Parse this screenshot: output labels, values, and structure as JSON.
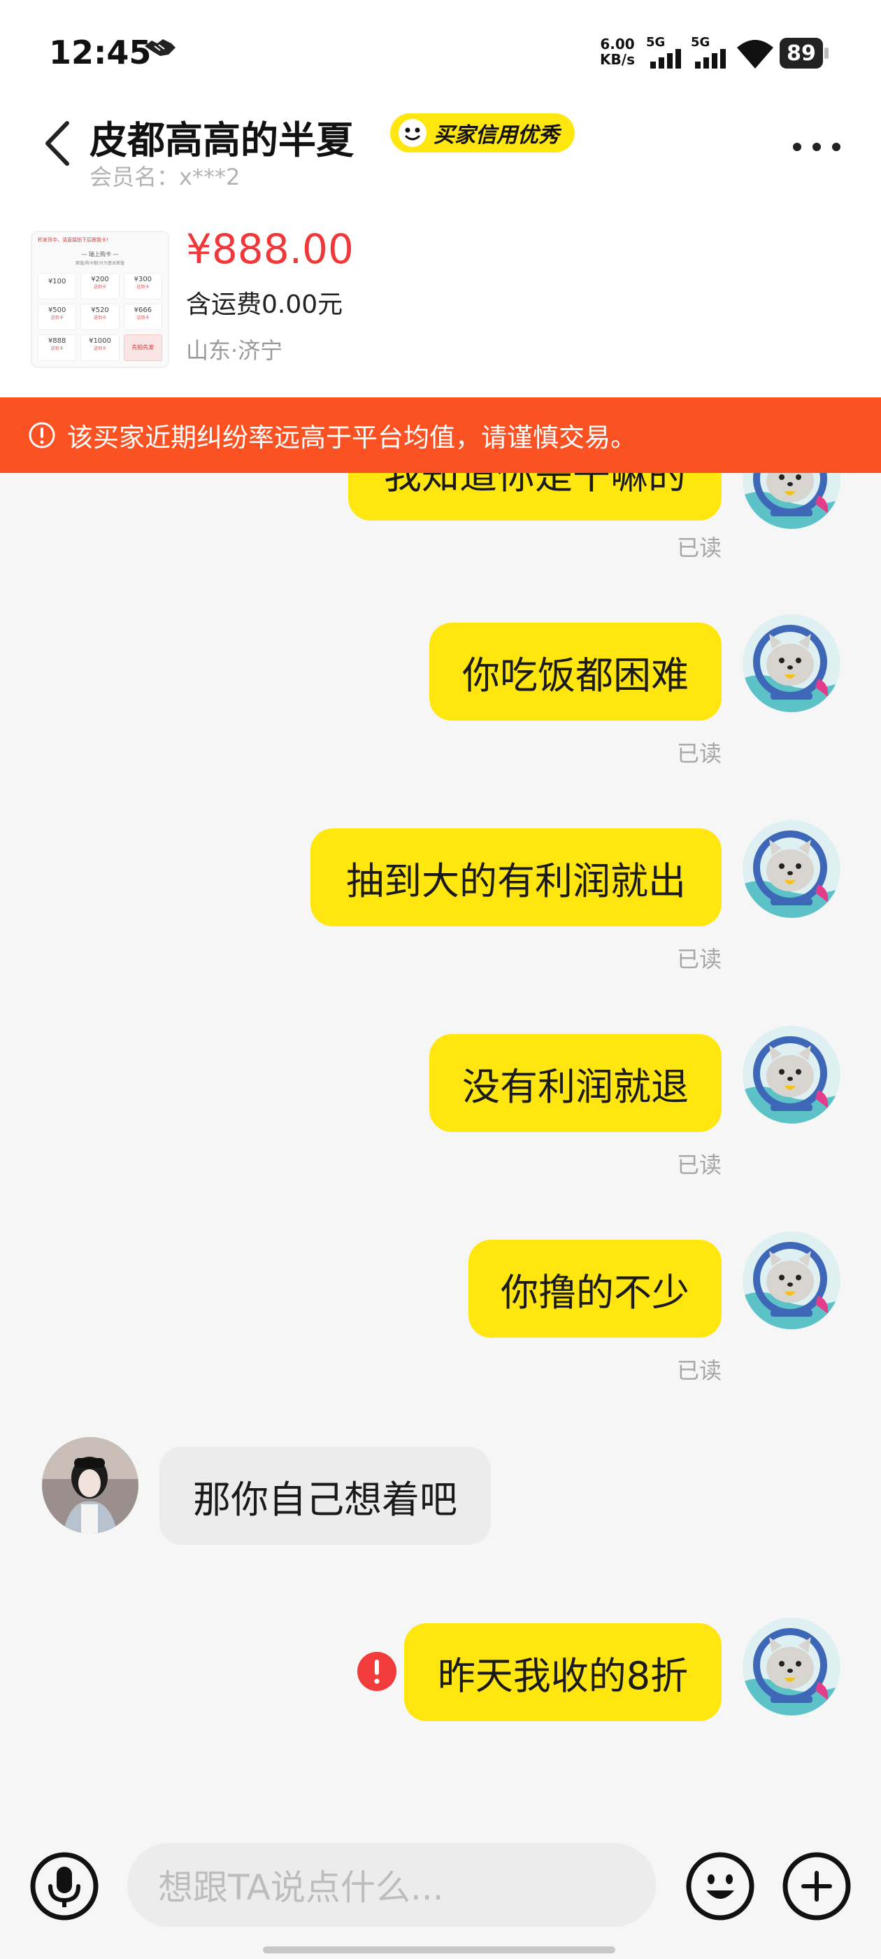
{
  "status_bar": {
    "time": "12:45",
    "net_speed_value": "6.00",
    "net_speed_unit": "KB/s",
    "signal_1_label": "5G",
    "signal_2_label": "5G",
    "battery": "89"
  },
  "header": {
    "title": "皮都高高的半夏",
    "badge": "买家信用优秀",
    "member_name": "会员名：x***2"
  },
  "product": {
    "price": "¥888.00",
    "shipping": "含运费0.00元",
    "location": "山东·济宁",
    "thumbnail": {
      "top_line": "秒发货中，请直接拍下后跟我卡！",
      "title": "— 瑞上购卡 —",
      "subtitle": "面值/购卡额/分为基本面值",
      "cells": [
        {
          "value": "¥100",
          "label": ""
        },
        {
          "value": "¥200",
          "label": "送到卡"
        },
        {
          "value": "¥300",
          "label": "送到卡"
        },
        {
          "value": "¥500",
          "label": "送到卡"
        },
        {
          "value": "¥520",
          "label": "送到卡"
        },
        {
          "value": "¥666",
          "label": "送到卡"
        },
        {
          "value": "¥888",
          "label": "送到卡"
        },
        {
          "value": "¥1000",
          "label": "送到卡"
        },
        {
          "value": "先拍先发",
          "label": ""
        }
      ]
    }
  },
  "warning": {
    "text": "该买家近期纠纷率远高于平台均值，请谨慎交易。"
  },
  "messages": [
    {
      "sender": "me",
      "text": "我知道你是干嘛的",
      "status": "已读"
    },
    {
      "sender": "me",
      "text": "你吃饭都困难",
      "status": "已读"
    },
    {
      "sender": "me",
      "text": "抽到大的有利润就出",
      "status": "已读"
    },
    {
      "sender": "me",
      "text": "没有利润就退",
      "status": "已读"
    },
    {
      "sender": "me",
      "text": "你撸的不少",
      "status": "已读"
    },
    {
      "sender": "them",
      "text": "那你自己想着吧"
    },
    {
      "sender": "me",
      "text": "昨天我收的8折",
      "status": "failed"
    }
  ],
  "input": {
    "placeholder": "想跟TA说点什么..."
  },
  "colors": {
    "accent_yellow": "#ffe60f",
    "warning_orange": "#fa5223",
    "price_red": "#f0383b",
    "error_red": "#f23b3b"
  },
  "icons": {
    "back": "chevron-left-icon",
    "more": "more-dots-icon",
    "mic": "microphone-icon",
    "emoji": "emoji-icon",
    "plus": "plus-icon",
    "warning": "alert-circle-icon",
    "error": "error-icon"
  }
}
